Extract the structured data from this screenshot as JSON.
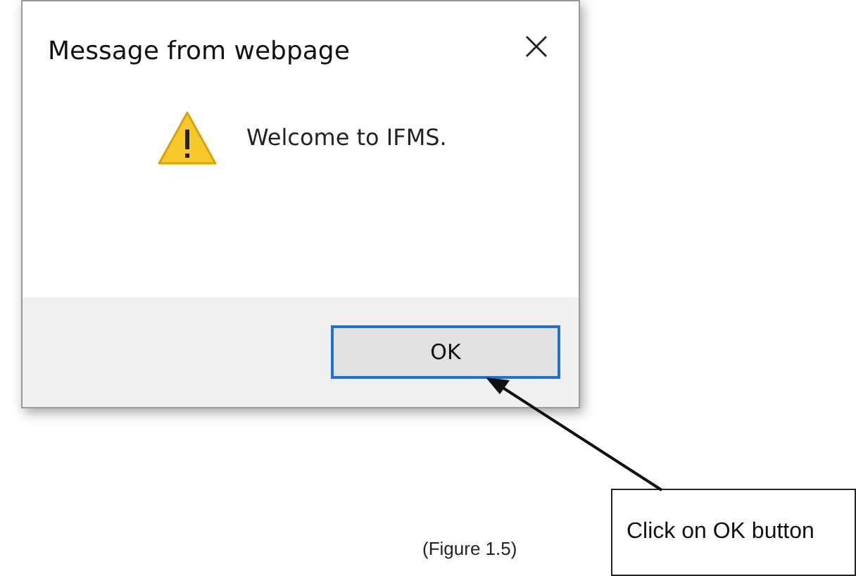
{
  "dialog": {
    "title": "Message from webpage",
    "message": "Welcome to IFMS.",
    "buttons": [
      {
        "label": "OK",
        "focused": true
      }
    ]
  },
  "caption": "(Figure 1.5)",
  "callout": {
    "text": "Click on OK button"
  }
}
